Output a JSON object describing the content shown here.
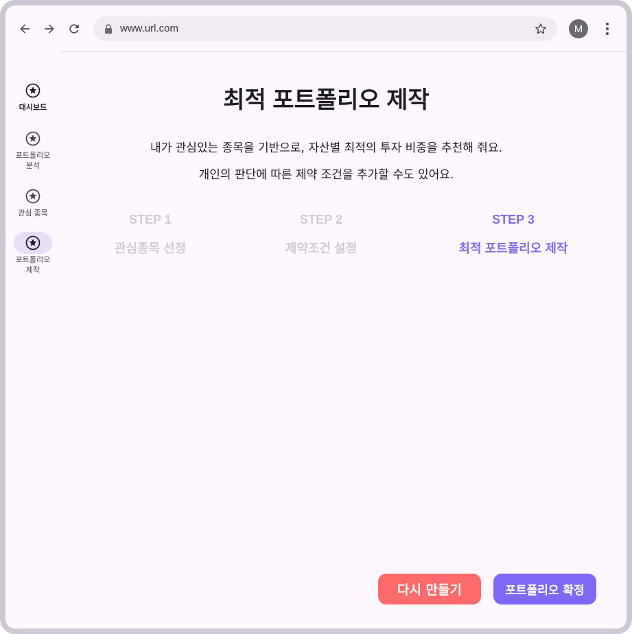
{
  "browser": {
    "url": "www.url.com",
    "avatar_letter": "M"
  },
  "sidebar": {
    "items": [
      {
        "label": "대시보드",
        "icon": "star-circle-icon",
        "active": false,
        "bold": true
      },
      {
        "label": "포트폴리오\n분석",
        "icon": "star-circle-icon",
        "active": false,
        "bold": false
      },
      {
        "label": "관심 종목",
        "icon": "star-circle-icon",
        "active": false,
        "bold": false
      },
      {
        "label": "포트폴리오\n제작",
        "icon": "star-circle-icon",
        "active": true,
        "bold": false
      }
    ]
  },
  "main": {
    "title": "최적 포트폴리오 제작",
    "description_line1": "내가 관심있는 종목을 기반으로, 자산별 최적의 투자 비중을 추천해 줘요.",
    "description_line2": "개인의 판단에 따른 제약 조건을 추가할 수도 있어요.",
    "steps": [
      {
        "number": "STEP 1",
        "name": "관심종목 선정",
        "state": "inactive"
      },
      {
        "number": "STEP 2",
        "name": "제약조건 설정",
        "state": "inactive"
      },
      {
        "number": "STEP 3",
        "name": "최적 포트폴리오 제작",
        "state": "active"
      }
    ],
    "buttons": {
      "retry": "다시 만들기",
      "confirm": "포트폴리오 확정"
    }
  },
  "colors": {
    "accent": "#7d69f5",
    "retry": "#ff6b6b",
    "inactive_step": "#cfcbd3",
    "background": "#fef7ff"
  }
}
